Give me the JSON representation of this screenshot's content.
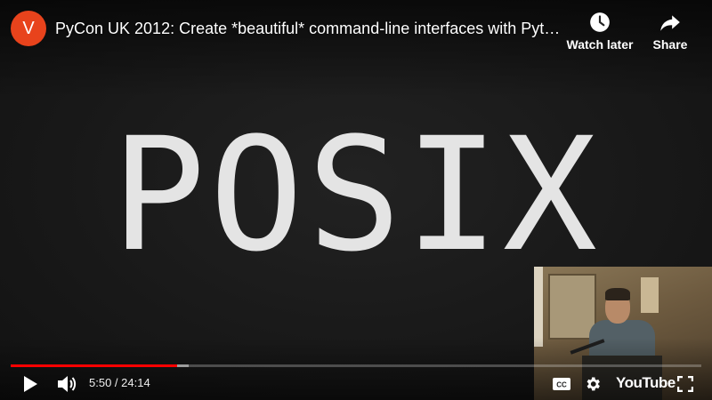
{
  "header": {
    "channel_initial": "V",
    "title": "PyCon UK 2012: Create *beautiful* command-line interfaces with Pyt…",
    "watch_later_label": "Watch later",
    "share_label": "Share"
  },
  "video": {
    "slide_text": "POSIX"
  },
  "controls": {
    "current_time": "5:50",
    "duration": "24:14",
    "time_separator": " / ",
    "logo_text": "YouTube",
    "play_icon": "play-icon",
    "volume_icon": "volume-icon",
    "cc_icon": "closed-captions-icon",
    "settings_icon": "gear-icon",
    "fullscreen_icon": "fullscreen-icon"
  },
  "progress": {
    "played_fraction": 0.2407,
    "loaded_fraction": 0.2577
  },
  "colors": {
    "accent": "#ff0000",
    "channel_avatar": "#e8431c"
  }
}
